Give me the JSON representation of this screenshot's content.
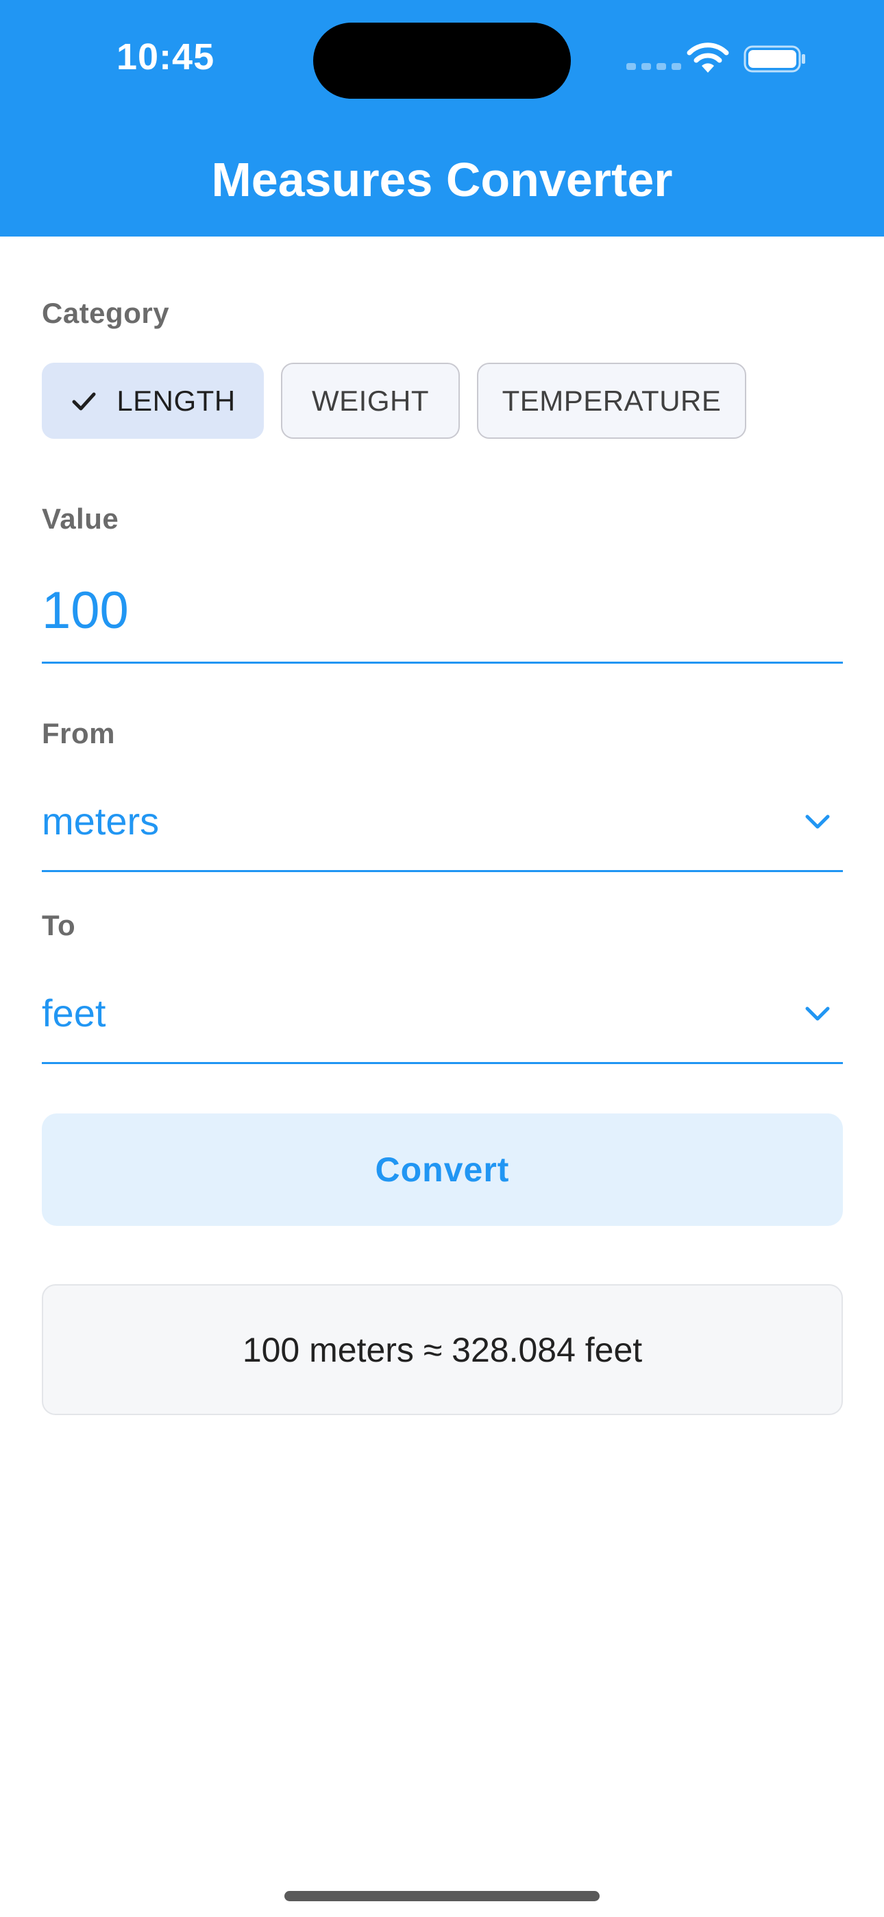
{
  "status_bar": {
    "time": "10:45"
  },
  "header": {
    "title": "Measures Converter",
    "background_color": "#2196F3"
  },
  "category": {
    "label": "Category",
    "options": [
      {
        "label": "LENGTH",
        "selected": true
      },
      {
        "label": "WEIGHT",
        "selected": false
      },
      {
        "label": "TEMPERATURE",
        "selected": false
      }
    ]
  },
  "value_field": {
    "label": "Value",
    "value": "100"
  },
  "from_field": {
    "label": "From",
    "value": "meters"
  },
  "to_field": {
    "label": "To",
    "value": "feet"
  },
  "convert_button": {
    "label": "Convert"
  },
  "result": {
    "text": "100 meters ≈ 328.084 feet"
  },
  "colors": {
    "accent": "#2196F3",
    "chip_selected_bg": "#dce6f8",
    "button_bg": "#e3f1fd"
  },
  "icons": [
    "check-icon",
    "chevron-down-icon",
    "wifi-icon",
    "battery-icon",
    "signal-icon"
  ]
}
